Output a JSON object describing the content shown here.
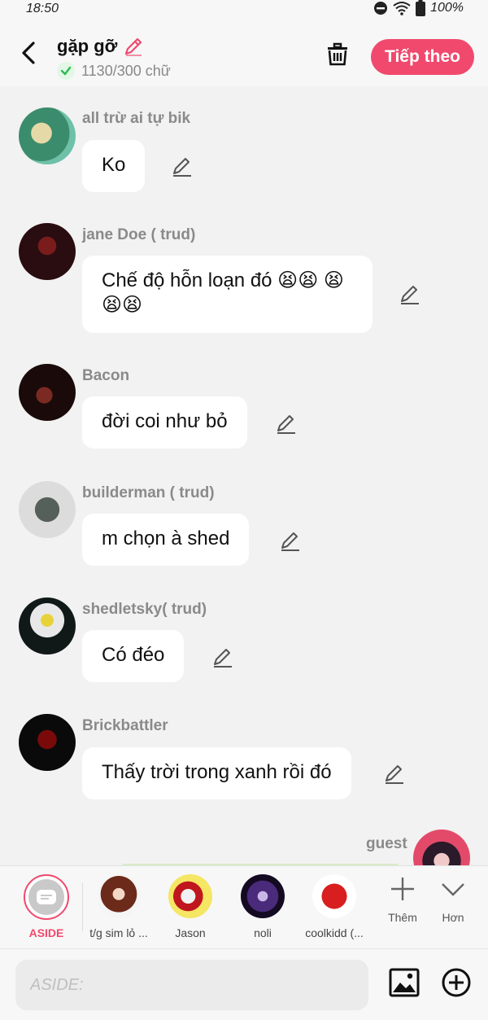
{
  "status": {
    "time": "18:50",
    "battery": "100%"
  },
  "header": {
    "title": "gặp gỡ",
    "word_count": "1130/300 chữ",
    "next_label": "Tiếp theo",
    "accent": "#f0496d"
  },
  "messages": [
    {
      "sender": "all trừ ai tự bik",
      "text": "Ko",
      "avatar_color": "#3a8d6a"
    },
    {
      "sender": "jane Doe ( trud)",
      "text": "Chế độ hỗn loạn đó 😫😫 😫😫😫",
      "avatar_color": "#2a0d10"
    },
    {
      "sender": "Bacon",
      "text": "đời coi như bỏ",
      "avatar_color": "#1a0a0a"
    },
    {
      "sender": "builderman ( trud)",
      "text": "m chọn à shed",
      "avatar_color": "#dcdcdc"
    },
    {
      "sender": "shedletsky( trud)",
      "text": "Có đéo",
      "avatar_color": "#101818"
    },
    {
      "sender": "Brickbattler",
      "text": "Thấy trời trong xanh rồi đó",
      "avatar_color": "#0a0a0a"
    }
  ],
  "guest": {
    "name": "guest"
  },
  "characters": [
    {
      "name": "ASIDE"
    },
    {
      "name": "t/g sim lỏ ..."
    },
    {
      "name": "Jason"
    },
    {
      "name": "noli"
    },
    {
      "name": "coolkidd (..."
    }
  ],
  "tools": {
    "more": "Thêm",
    "less": "Hơn"
  },
  "input": {
    "placeholder": "ASIDE:"
  }
}
